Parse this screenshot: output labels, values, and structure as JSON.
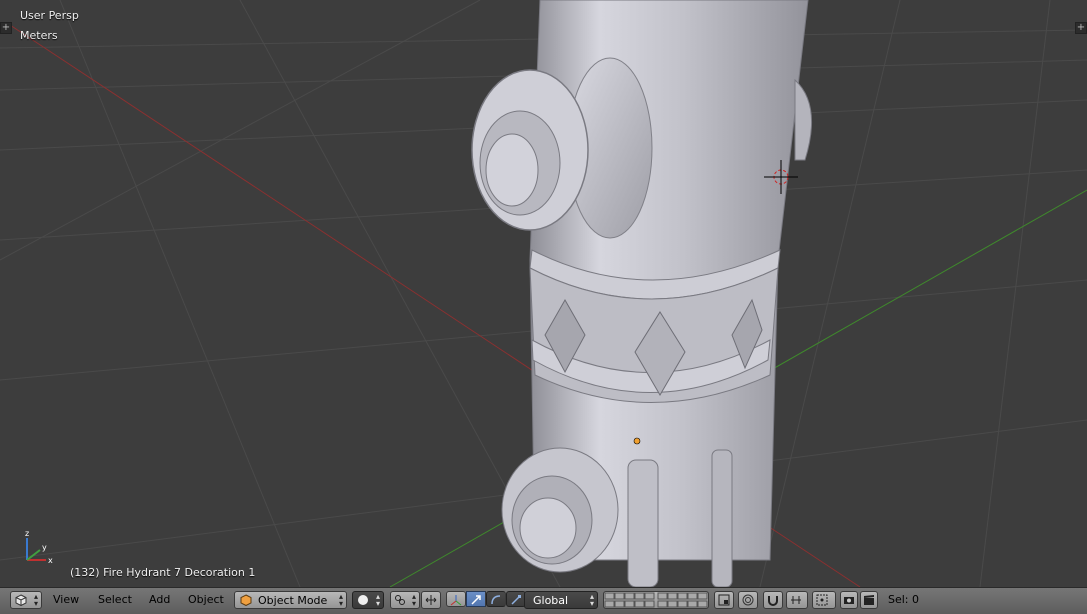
{
  "viewport": {
    "perspective_label": "User Persp",
    "units_label": "Meters",
    "object_info": "(132) Fire Hydrant 7 Decoration 1",
    "axis_labels": {
      "x": "x",
      "y": "y",
      "z": "z"
    },
    "colors": {
      "background": "#3d3d3d",
      "grid": "#4a4a4a",
      "x_axis": "#8b3030",
      "y_axis": "#3f8a2c",
      "mesh": "#c4c4cc"
    }
  },
  "header": {
    "menus": {
      "view": "View",
      "select": "Select",
      "add": "Add",
      "object": "Object"
    },
    "mode_label": "Object Mode",
    "orientation_label": "Global",
    "selection_count": "Sel: 0",
    "icons": [
      "editor-type-cube-icon",
      "viewport-shading-solid-icon",
      "pivot-point-icon",
      "manipulator-toggle-icon",
      "translate-icon",
      "rotate-icon",
      "scale-icon",
      "layers-grid",
      "lock-layers-icon",
      "proportional-editing-icon",
      "snap-magnet-icon",
      "snap-element-icon",
      "snap-target-icon",
      "render-camera-icon",
      "render-clapboard-icon"
    ]
  }
}
